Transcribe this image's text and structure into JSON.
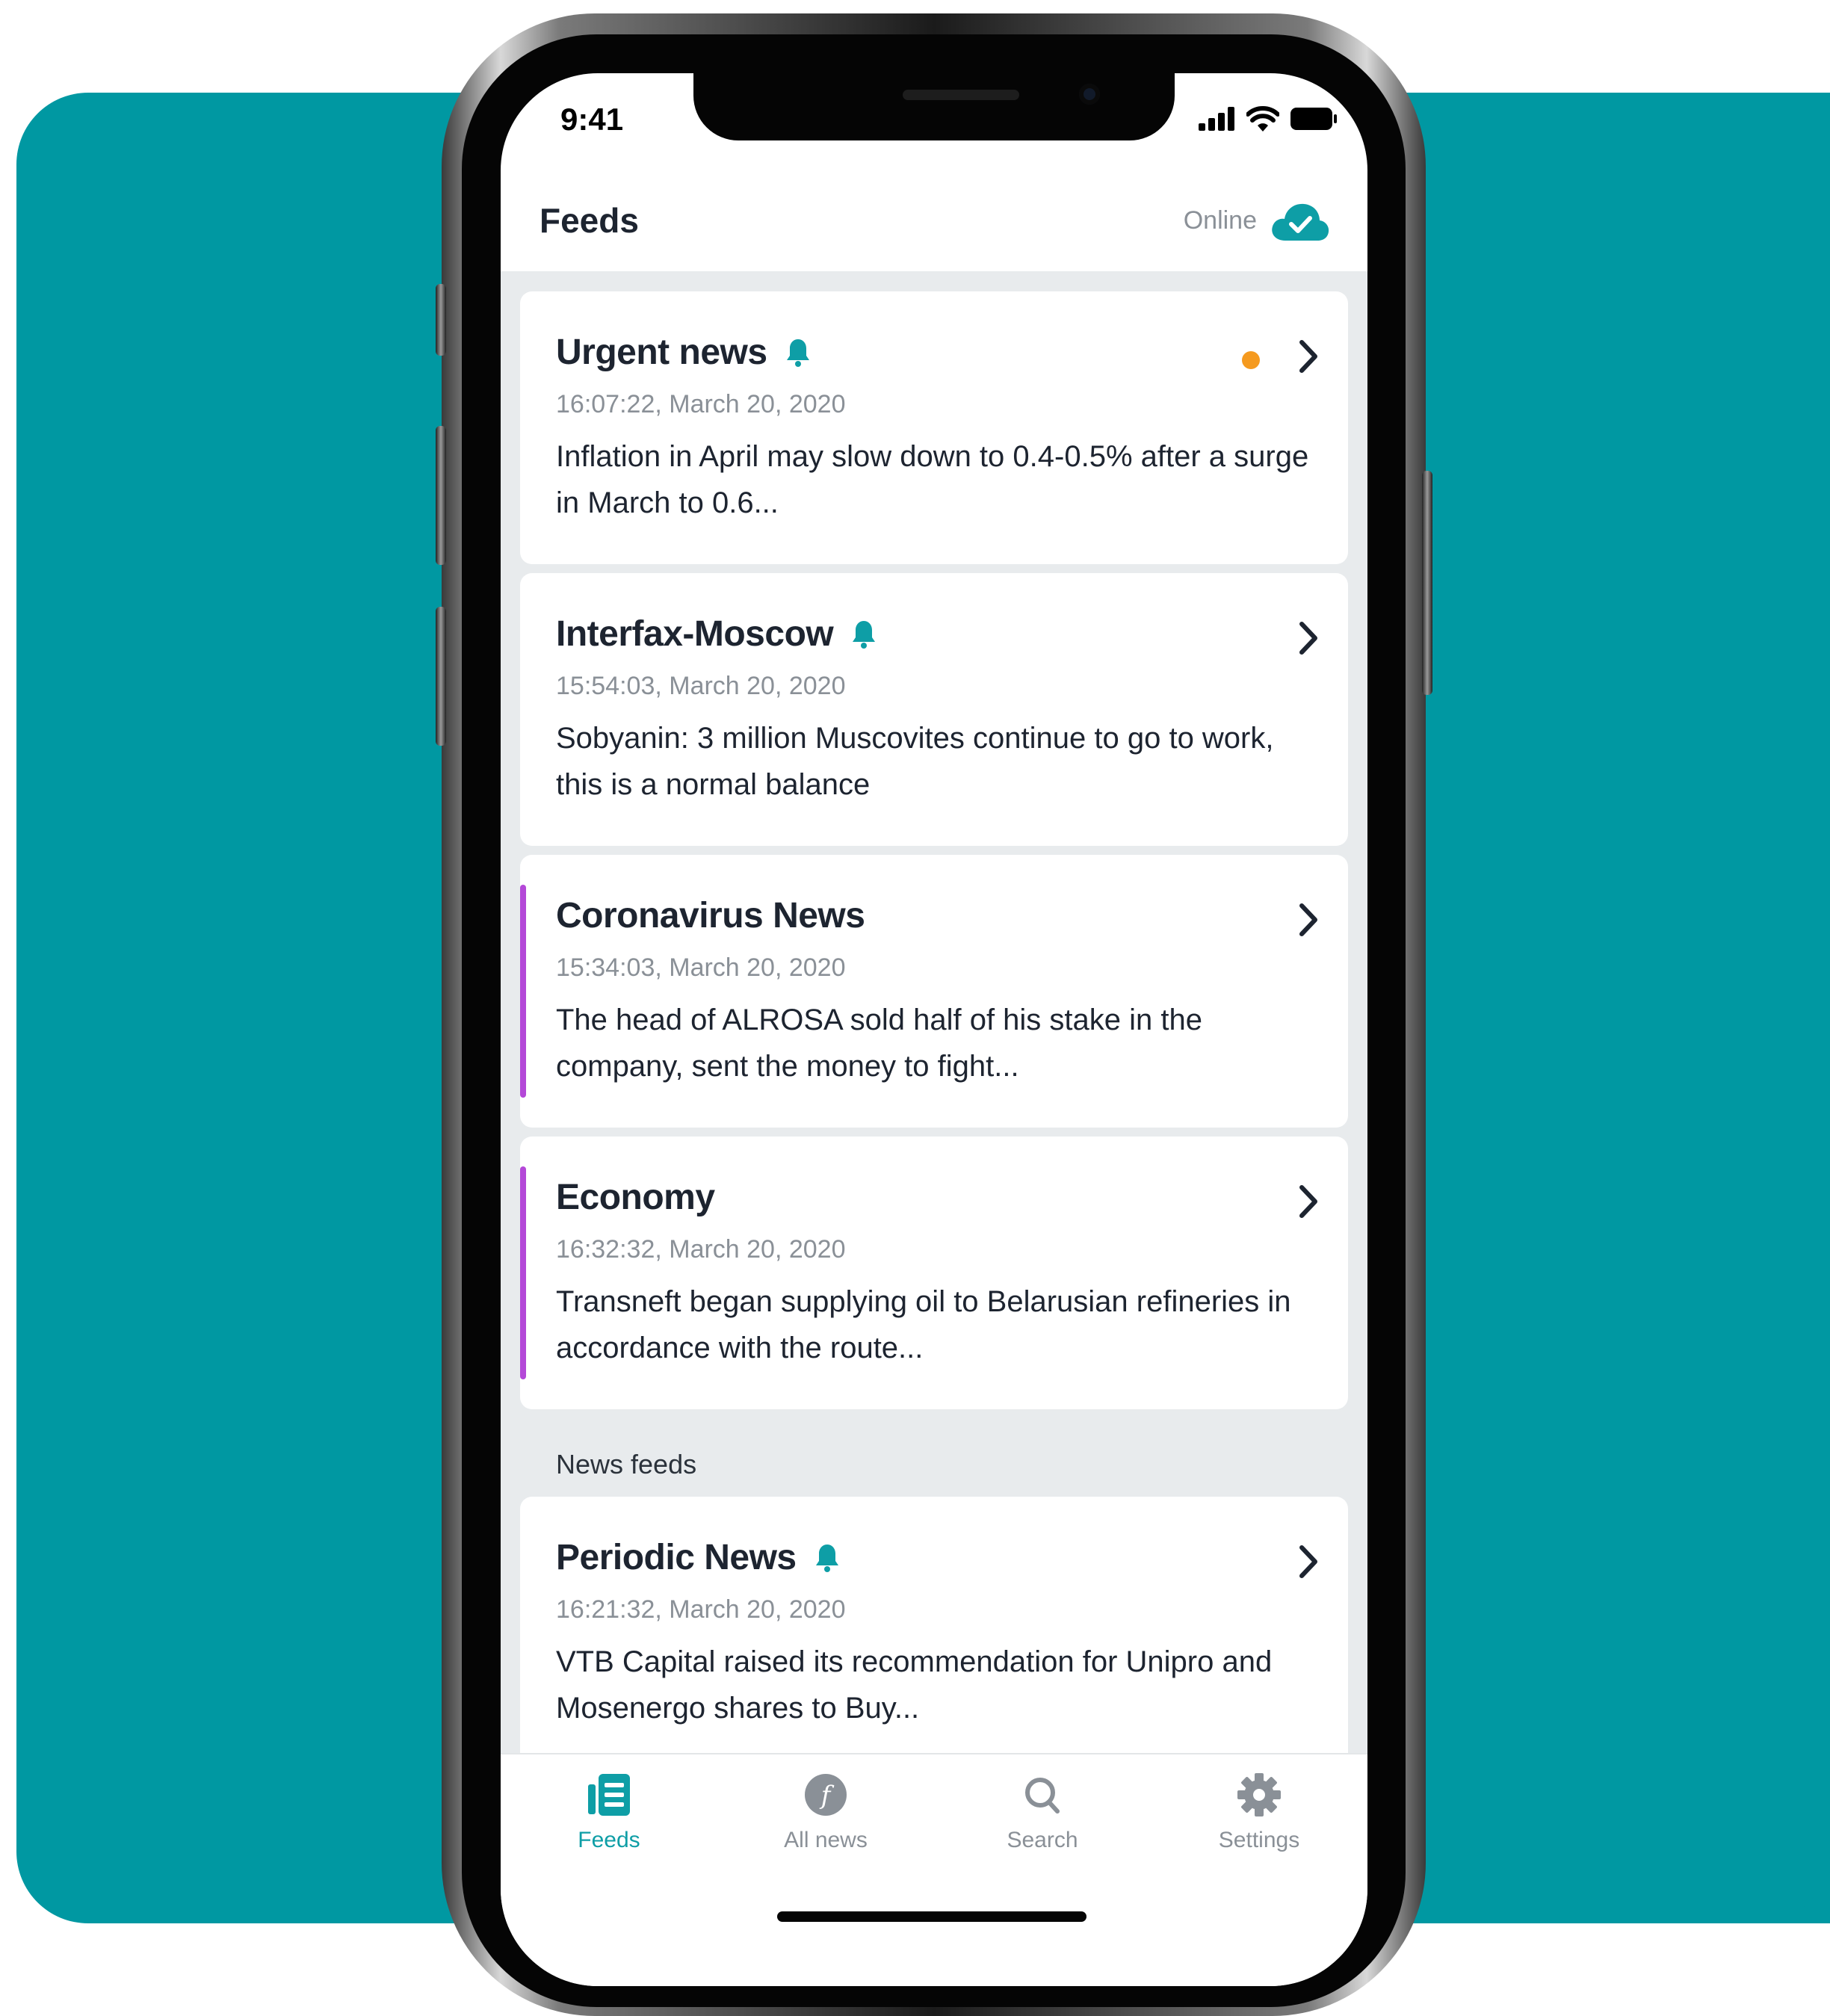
{
  "status_bar": {
    "time": "9:41"
  },
  "header": {
    "title": "Feeds",
    "status": "Online"
  },
  "cards": [
    {
      "title": "Urgent news",
      "time": "16:07:22, March 20, 2020",
      "text": "Inflation in April may slow down to 0.4-0.5% after a surge in March to 0.6...",
      "bell": true,
      "unread": true,
      "accent": false
    },
    {
      "title": "Interfax-Moscow",
      "time": "15:54:03, March 20, 2020",
      "text": "Sobyanin: 3 million Muscovites continue to go to work, this is a normal balance",
      "bell": true,
      "unread": false,
      "accent": false
    },
    {
      "title": "Coronavirus News",
      "time": "15:34:03, March 20, 2020",
      "text": "The head of ALROSA sold half of his stake in the company, sent the money to fight...",
      "bell": false,
      "unread": false,
      "accent": true
    },
    {
      "title": "Economy",
      "time": "16:32:32, March 20, 2020",
      "text": "Transneft began supplying oil to Belarusian refineries in accordance with the route...",
      "bell": false,
      "unread": false,
      "accent": true
    }
  ],
  "section": {
    "label": "News feeds"
  },
  "news_feeds": [
    {
      "title": "Periodic News",
      "time": "16:21:32, March 20, 2020",
      "text": "VTB Capital raised its recommendation for Unipro and Mosenergo shares to Buy...",
      "bell": true
    }
  ],
  "tabbar": {
    "feeds": "Feeds",
    "all_news": "All news",
    "search": "Search",
    "settings": "Settings"
  },
  "colors": {
    "background": "#0098a2",
    "accent": "#0e9ea6",
    "unread_dot": "#f59a1f",
    "feed_marker": "#b448d8"
  }
}
